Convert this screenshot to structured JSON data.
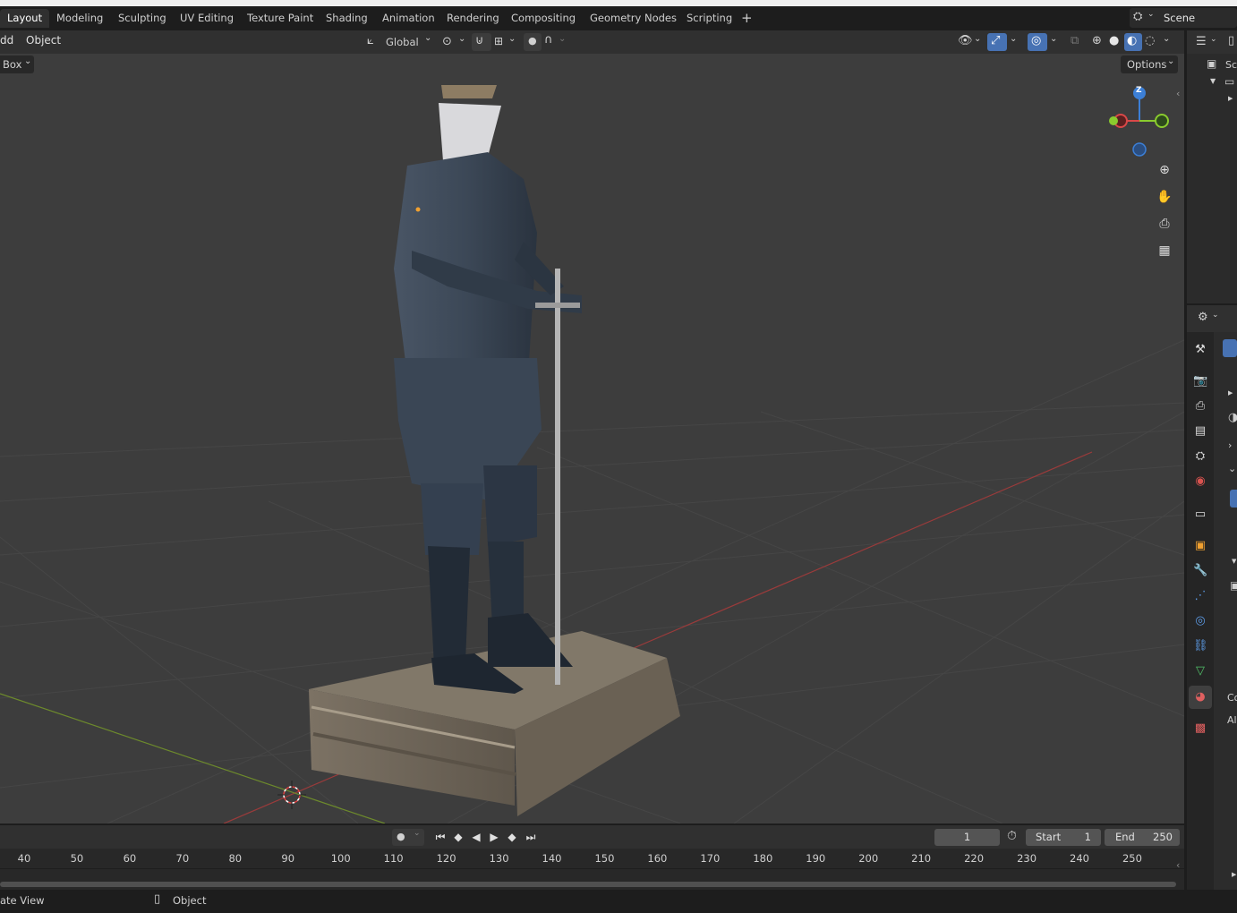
{
  "workspace_tabs": [
    "Layout",
    "Modeling",
    "Sculpting",
    "UV Editing",
    "Texture Paint",
    "Shading",
    "Animation",
    "Rendering",
    "Compositing",
    "Geometry Nodes",
    "Scripting"
  ],
  "add_workspace": "+",
  "scene_label": "Scene",
  "header": {
    "menu_add": "dd",
    "menu_object": "Object",
    "transform_orientation": "Global",
    "select_mode": "Box",
    "options_label": "Options"
  },
  "gizmo": {
    "z_label": "Z"
  },
  "outliner": {
    "scene_truncated": "Sc"
  },
  "props_side_text": {
    "co": "Co",
    "al": "Al"
  },
  "timeline": {
    "current_frame": "1",
    "start_label": "Start",
    "start_value": "1",
    "end_label": "End",
    "end_value": "250",
    "ruler": [
      "40",
      "50",
      "60",
      "70",
      "80",
      "90",
      "100",
      "110",
      "120",
      "130",
      "140",
      "150",
      "160",
      "170",
      "180",
      "190",
      "200",
      "210",
      "220",
      "230",
      "240",
      "250"
    ]
  },
  "status": {
    "left_text": "ate View",
    "mode_text": "Object"
  },
  "icons": {
    "zoom": "zoom-icon",
    "pan": "hand-icon",
    "camera": "camera-icon",
    "ortho": "grid-icon"
  }
}
